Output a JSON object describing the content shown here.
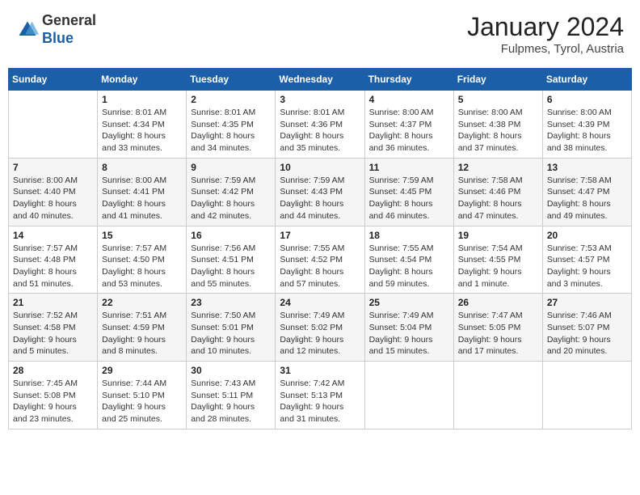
{
  "header": {
    "logo_line1": "General",
    "logo_line2": "Blue",
    "month_year": "January 2024",
    "location": "Fulpmes, Tyrol, Austria"
  },
  "weekdays": [
    "Sunday",
    "Monday",
    "Tuesday",
    "Wednesday",
    "Thursday",
    "Friday",
    "Saturday"
  ],
  "weeks": [
    [
      {
        "day": "",
        "sunrise": "",
        "sunset": "",
        "daylight": ""
      },
      {
        "day": "1",
        "sunrise": "Sunrise: 8:01 AM",
        "sunset": "Sunset: 4:34 PM",
        "daylight": "Daylight: 8 hours and 33 minutes."
      },
      {
        "day": "2",
        "sunrise": "Sunrise: 8:01 AM",
        "sunset": "Sunset: 4:35 PM",
        "daylight": "Daylight: 8 hours and 34 minutes."
      },
      {
        "day": "3",
        "sunrise": "Sunrise: 8:01 AM",
        "sunset": "Sunset: 4:36 PM",
        "daylight": "Daylight: 8 hours and 35 minutes."
      },
      {
        "day": "4",
        "sunrise": "Sunrise: 8:00 AM",
        "sunset": "Sunset: 4:37 PM",
        "daylight": "Daylight: 8 hours and 36 minutes."
      },
      {
        "day": "5",
        "sunrise": "Sunrise: 8:00 AM",
        "sunset": "Sunset: 4:38 PM",
        "daylight": "Daylight: 8 hours and 37 minutes."
      },
      {
        "day": "6",
        "sunrise": "Sunrise: 8:00 AM",
        "sunset": "Sunset: 4:39 PM",
        "daylight": "Daylight: 8 hours and 38 minutes."
      }
    ],
    [
      {
        "day": "7",
        "sunrise": "Sunrise: 8:00 AM",
        "sunset": "Sunset: 4:40 PM",
        "daylight": "Daylight: 8 hours and 40 minutes."
      },
      {
        "day": "8",
        "sunrise": "Sunrise: 8:00 AM",
        "sunset": "Sunset: 4:41 PM",
        "daylight": "Daylight: 8 hours and 41 minutes."
      },
      {
        "day": "9",
        "sunrise": "Sunrise: 7:59 AM",
        "sunset": "Sunset: 4:42 PM",
        "daylight": "Daylight: 8 hours and 42 minutes."
      },
      {
        "day": "10",
        "sunrise": "Sunrise: 7:59 AM",
        "sunset": "Sunset: 4:43 PM",
        "daylight": "Daylight: 8 hours and 44 minutes."
      },
      {
        "day": "11",
        "sunrise": "Sunrise: 7:59 AM",
        "sunset": "Sunset: 4:45 PM",
        "daylight": "Daylight: 8 hours and 46 minutes."
      },
      {
        "day": "12",
        "sunrise": "Sunrise: 7:58 AM",
        "sunset": "Sunset: 4:46 PM",
        "daylight": "Daylight: 8 hours and 47 minutes."
      },
      {
        "day": "13",
        "sunrise": "Sunrise: 7:58 AM",
        "sunset": "Sunset: 4:47 PM",
        "daylight": "Daylight: 8 hours and 49 minutes."
      }
    ],
    [
      {
        "day": "14",
        "sunrise": "Sunrise: 7:57 AM",
        "sunset": "Sunset: 4:48 PM",
        "daylight": "Daylight: 8 hours and 51 minutes."
      },
      {
        "day": "15",
        "sunrise": "Sunrise: 7:57 AM",
        "sunset": "Sunset: 4:50 PM",
        "daylight": "Daylight: 8 hours and 53 minutes."
      },
      {
        "day": "16",
        "sunrise": "Sunrise: 7:56 AM",
        "sunset": "Sunset: 4:51 PM",
        "daylight": "Daylight: 8 hours and 55 minutes."
      },
      {
        "day": "17",
        "sunrise": "Sunrise: 7:55 AM",
        "sunset": "Sunset: 4:52 PM",
        "daylight": "Daylight: 8 hours and 57 minutes."
      },
      {
        "day": "18",
        "sunrise": "Sunrise: 7:55 AM",
        "sunset": "Sunset: 4:54 PM",
        "daylight": "Daylight: 8 hours and 59 minutes."
      },
      {
        "day": "19",
        "sunrise": "Sunrise: 7:54 AM",
        "sunset": "Sunset: 4:55 PM",
        "daylight": "Daylight: 9 hours and 1 minute."
      },
      {
        "day": "20",
        "sunrise": "Sunrise: 7:53 AM",
        "sunset": "Sunset: 4:57 PM",
        "daylight": "Daylight: 9 hours and 3 minutes."
      }
    ],
    [
      {
        "day": "21",
        "sunrise": "Sunrise: 7:52 AM",
        "sunset": "Sunset: 4:58 PM",
        "daylight": "Daylight: 9 hours and 5 minutes."
      },
      {
        "day": "22",
        "sunrise": "Sunrise: 7:51 AM",
        "sunset": "Sunset: 4:59 PM",
        "daylight": "Daylight: 9 hours and 8 minutes."
      },
      {
        "day": "23",
        "sunrise": "Sunrise: 7:50 AM",
        "sunset": "Sunset: 5:01 PM",
        "daylight": "Daylight: 9 hours and 10 minutes."
      },
      {
        "day": "24",
        "sunrise": "Sunrise: 7:49 AM",
        "sunset": "Sunset: 5:02 PM",
        "daylight": "Daylight: 9 hours and 12 minutes."
      },
      {
        "day": "25",
        "sunrise": "Sunrise: 7:49 AM",
        "sunset": "Sunset: 5:04 PM",
        "daylight": "Daylight: 9 hours and 15 minutes."
      },
      {
        "day": "26",
        "sunrise": "Sunrise: 7:47 AM",
        "sunset": "Sunset: 5:05 PM",
        "daylight": "Daylight: 9 hours and 17 minutes."
      },
      {
        "day": "27",
        "sunrise": "Sunrise: 7:46 AM",
        "sunset": "Sunset: 5:07 PM",
        "daylight": "Daylight: 9 hours and 20 minutes."
      }
    ],
    [
      {
        "day": "28",
        "sunrise": "Sunrise: 7:45 AM",
        "sunset": "Sunset: 5:08 PM",
        "daylight": "Daylight: 9 hours and 23 minutes."
      },
      {
        "day": "29",
        "sunrise": "Sunrise: 7:44 AM",
        "sunset": "Sunset: 5:10 PM",
        "daylight": "Daylight: 9 hours and 25 minutes."
      },
      {
        "day": "30",
        "sunrise": "Sunrise: 7:43 AM",
        "sunset": "Sunset: 5:11 PM",
        "daylight": "Daylight: 9 hours and 28 minutes."
      },
      {
        "day": "31",
        "sunrise": "Sunrise: 7:42 AM",
        "sunset": "Sunset: 5:13 PM",
        "daylight": "Daylight: 9 hours and 31 minutes."
      },
      {
        "day": "",
        "sunrise": "",
        "sunset": "",
        "daylight": ""
      },
      {
        "day": "",
        "sunrise": "",
        "sunset": "",
        "daylight": ""
      },
      {
        "day": "",
        "sunrise": "",
        "sunset": "",
        "daylight": ""
      }
    ]
  ]
}
